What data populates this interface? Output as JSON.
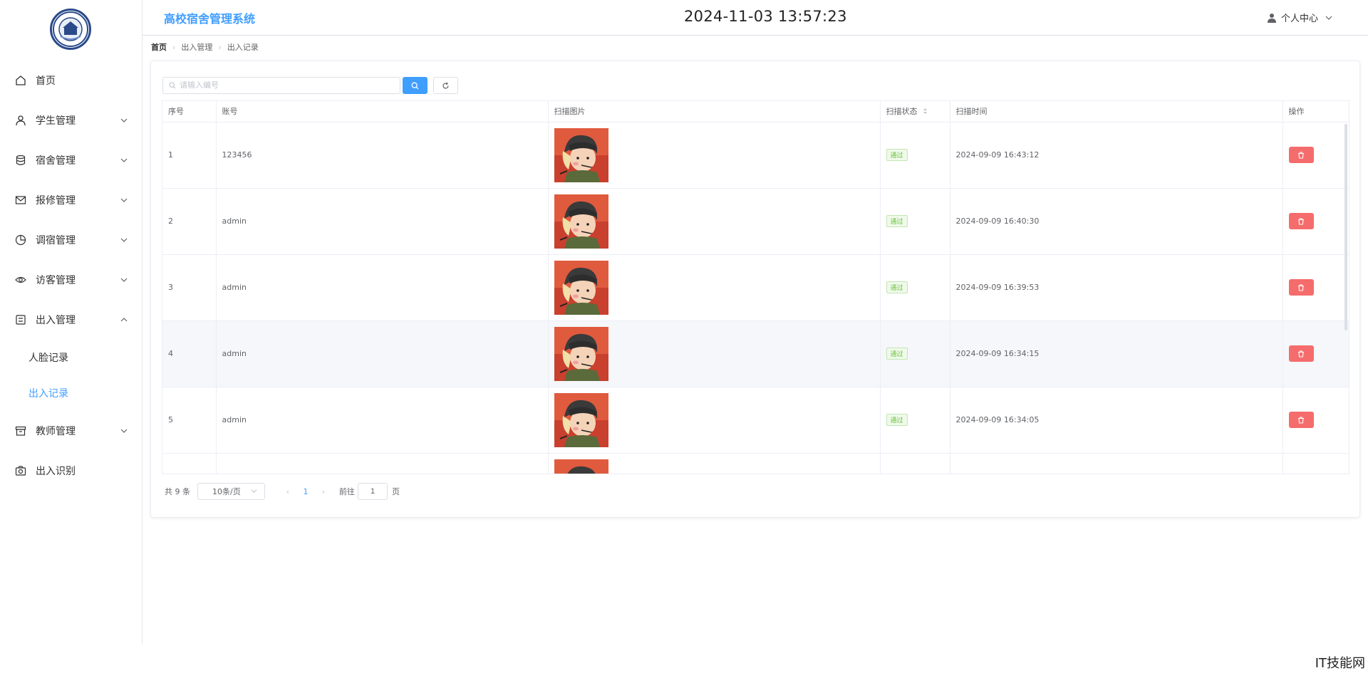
{
  "app": {
    "title": "高校宿舍管理系统",
    "clock": "2024-11-03 13:57:23",
    "user_menu": "个人中心"
  },
  "sidebar": {
    "items": [
      {
        "label": "首页",
        "icon": "home-icon",
        "has_arrow": false
      },
      {
        "label": "学生管理",
        "icon": "user-icon",
        "has_arrow": true
      },
      {
        "label": "宿舍管理",
        "icon": "database-icon",
        "has_arrow": true
      },
      {
        "label": "报修管理",
        "icon": "mail-icon",
        "has_arrow": true
      },
      {
        "label": "调宿管理",
        "icon": "pie-chart-icon",
        "has_arrow": true
      },
      {
        "label": "访客管理",
        "icon": "eye-icon",
        "has_arrow": true
      },
      {
        "label": "出入管理",
        "icon": "tickets-icon",
        "has_arrow": true,
        "expanded": true
      },
      {
        "label": "教师管理",
        "icon": "box-icon",
        "has_arrow": true
      },
      {
        "label": "出入识别",
        "icon": "camera-icon",
        "has_arrow": false
      }
    ],
    "submenu": [
      {
        "label": "人脸记录",
        "active": false
      },
      {
        "label": "出入记录",
        "active": true
      }
    ]
  },
  "breadcrumb": [
    "首页",
    "出入管理",
    "出入记录"
  ],
  "search": {
    "placeholder": "请输入编号",
    "value": ""
  },
  "table": {
    "headers": [
      "序号",
      "账号",
      "扫描图片",
      "扫描状态",
      "扫描时间",
      "操作"
    ],
    "rows": [
      {
        "index": "1",
        "account": "123456",
        "status": "通过",
        "time": "2024-09-09 16:43:12"
      },
      {
        "index": "2",
        "account": "admin",
        "status": "通过",
        "time": "2024-09-09 16:40:30"
      },
      {
        "index": "3",
        "account": "admin",
        "status": "通过",
        "time": "2024-09-09 16:39:53"
      },
      {
        "index": "4",
        "account": "admin",
        "status": "通过",
        "time": "2024-09-09 16:34:15"
      },
      {
        "index": "5",
        "account": "admin",
        "status": "通过",
        "time": "2024-09-09 16:34:05"
      },
      {
        "index": "",
        "account": "",
        "status": "",
        "time": ""
      }
    ]
  },
  "pagination": {
    "total": "共 9 条",
    "page_size": "10条/页",
    "current_page": "1",
    "goto_label": "前往",
    "goto_value": "1",
    "unit": "页"
  },
  "colors": {
    "primary": "#409eff",
    "danger": "#f56c6c",
    "success": "#67c23a"
  },
  "watermark": "IT技能网"
}
